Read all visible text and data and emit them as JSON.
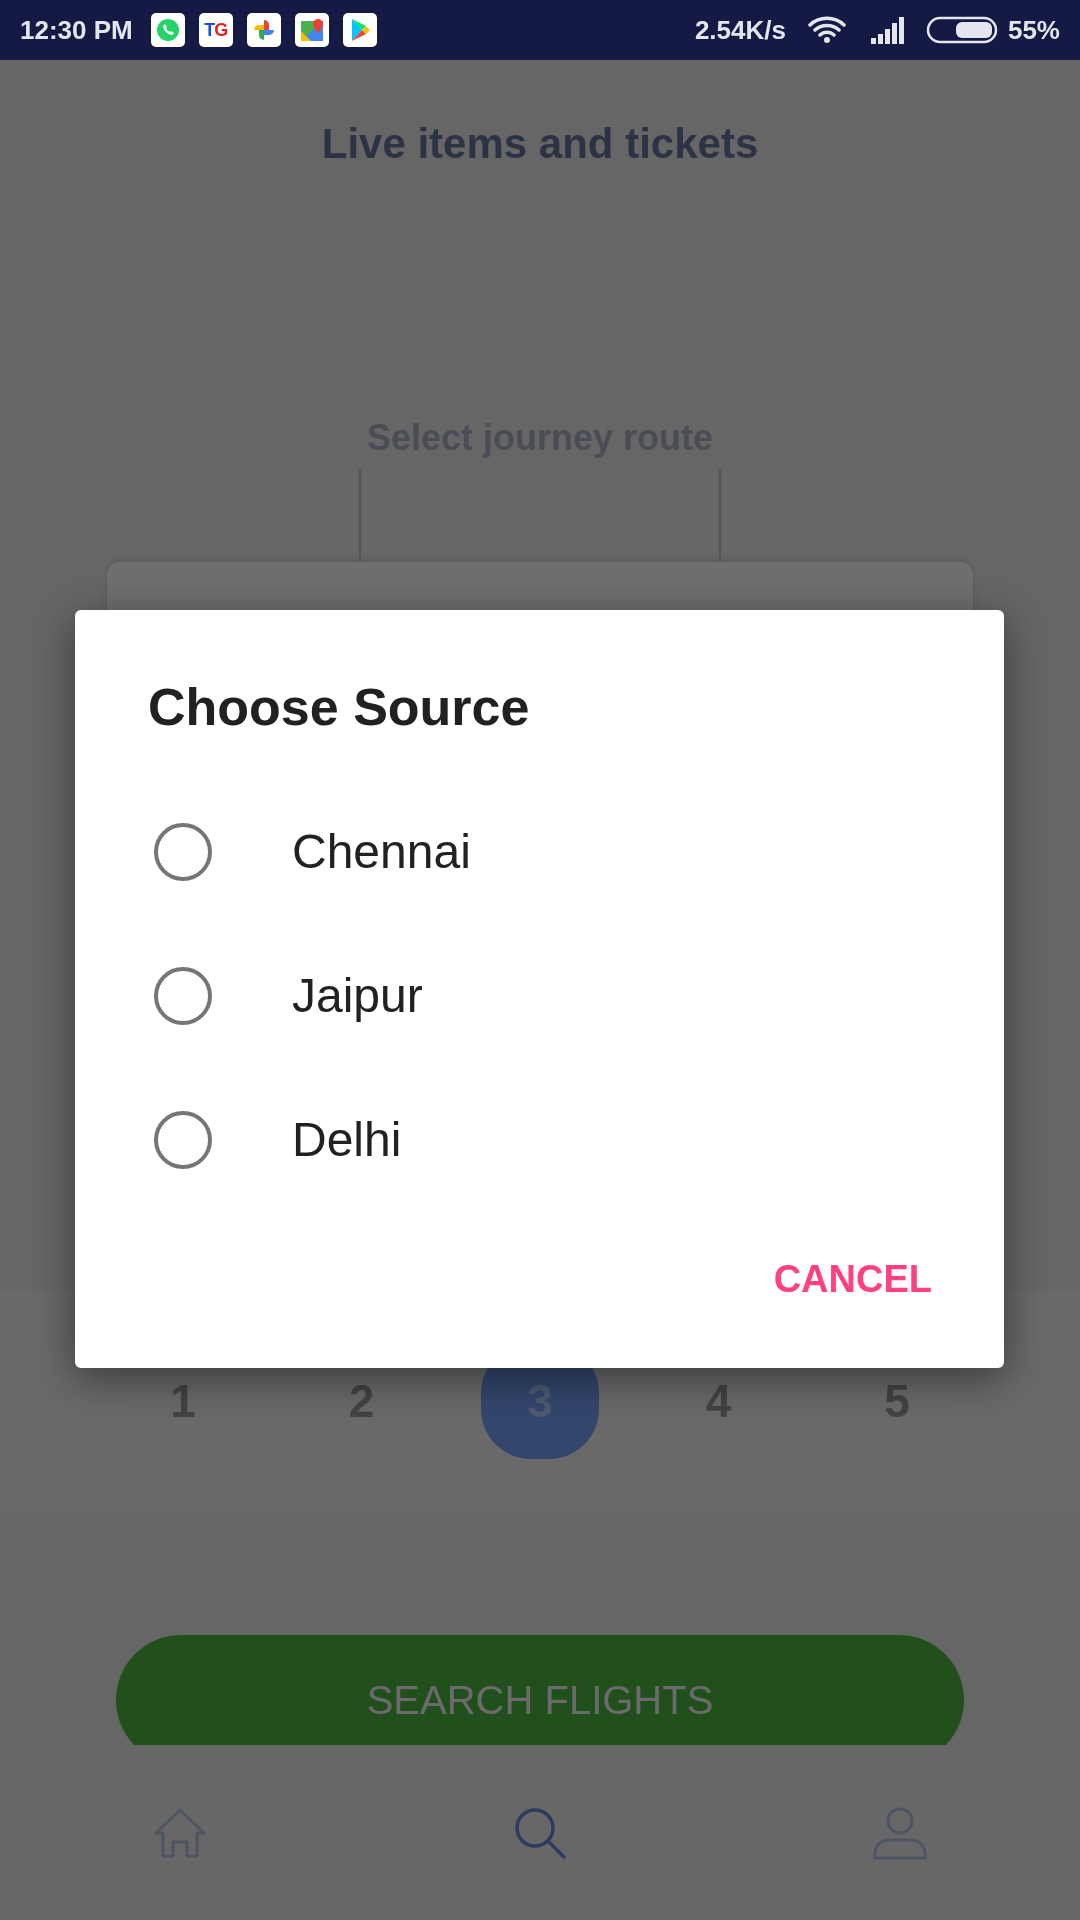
{
  "status_bar": {
    "time": "12:30 PM",
    "tg_icon_label": "TG",
    "speed": "2.54K/s",
    "battery": "55%"
  },
  "page": {
    "title": "Live items and tickets",
    "route_label": "Select journey route"
  },
  "pager": [
    {
      "label": "1",
      "selected": false
    },
    {
      "label": "2",
      "selected": false
    },
    {
      "label": "3",
      "selected": true
    },
    {
      "label": "4",
      "selected": false
    },
    {
      "label": "5",
      "selected": false
    }
  ],
  "search_button": "SEARCH FLIGHTS",
  "bottom_nav": [
    {
      "kind": "home",
      "selected": false
    },
    {
      "kind": "search",
      "selected": true
    },
    {
      "kind": "profile",
      "selected": false
    }
  ],
  "dialog": {
    "title": "Choose Source",
    "options": [
      {
        "label": "Chennai",
        "selected": false
      },
      {
        "label": "Jaipur",
        "selected": false
      },
      {
        "label": "Delhi",
        "selected": false
      }
    ],
    "cancel": "CANCEL"
  }
}
